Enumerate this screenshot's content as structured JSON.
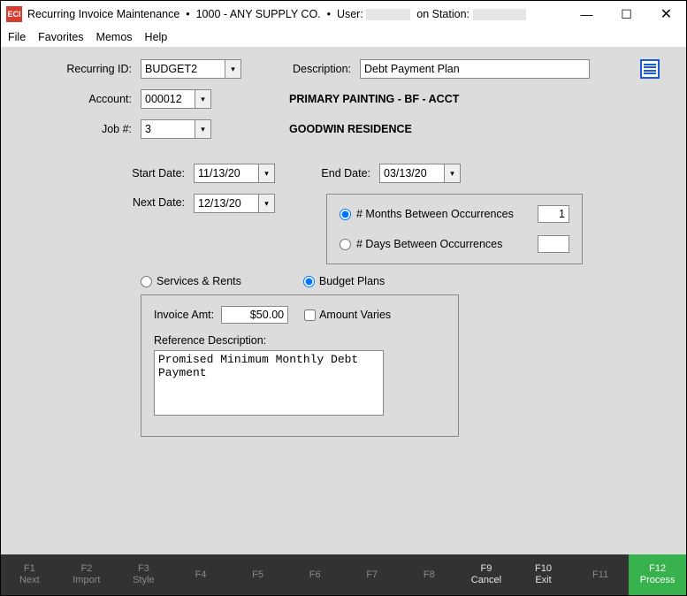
{
  "titlebar": {
    "app": "Recurring Invoice Maintenance",
    "company": "1000 - ANY SUPPLY CO.",
    "user_label": "User:",
    "station_label": "on Station:"
  },
  "menu": {
    "file": "File",
    "favorites": "Favorites",
    "memos": "Memos",
    "help": "Help"
  },
  "labels": {
    "recurring_id": "Recurring ID:",
    "description": "Description:",
    "account": "Account:",
    "job": "Job #:",
    "start_date": "Start Date:",
    "end_date": "End Date:",
    "next_date": "Next Date:",
    "months_between": "# Months Between Occurrences",
    "days_between": "# Days Between Occurrences",
    "services_rents": "Services & Rents",
    "budget_plans": "Budget Plans",
    "invoice_amt": "Invoice Amt:",
    "amount_varies": "Amount Varies",
    "reference_description": "Reference Description:"
  },
  "values": {
    "recurring_id": "BUDGET2",
    "description": "Debt Payment Plan",
    "account": "000012",
    "account_name": "PRIMARY PAINTING - BF - ACCT",
    "job": "3",
    "job_name": "GOODWIN RESIDENCE",
    "start_date": "11/13/20",
    "end_date": "03/13/20",
    "next_date": "12/13/20",
    "months_between": "1",
    "days_between": "",
    "invoice_amt": "$50.00",
    "reference_description": "Promised Minimum Monthly Debt Payment"
  },
  "state": {
    "occurrence": "months",
    "plan_type": "budget",
    "amount_varies": false
  },
  "fkeys": {
    "f1": {
      "k": "F1",
      "l": "Next"
    },
    "f2": {
      "k": "F2",
      "l": "Import"
    },
    "f3": {
      "k": "F3",
      "l": "Style"
    },
    "f4": {
      "k": "F4",
      "l": ""
    },
    "f5": {
      "k": "F5",
      "l": ""
    },
    "f6": {
      "k": "F6",
      "l": ""
    },
    "f7": {
      "k": "F7",
      "l": ""
    },
    "f8": {
      "k": "F8",
      "l": ""
    },
    "f9": {
      "k": "F9",
      "l": "Cancel"
    },
    "f10": {
      "k": "F10",
      "l": "Exit"
    },
    "f11": {
      "k": "F11",
      "l": ""
    },
    "f12": {
      "k": "F12",
      "l": "Process"
    }
  }
}
